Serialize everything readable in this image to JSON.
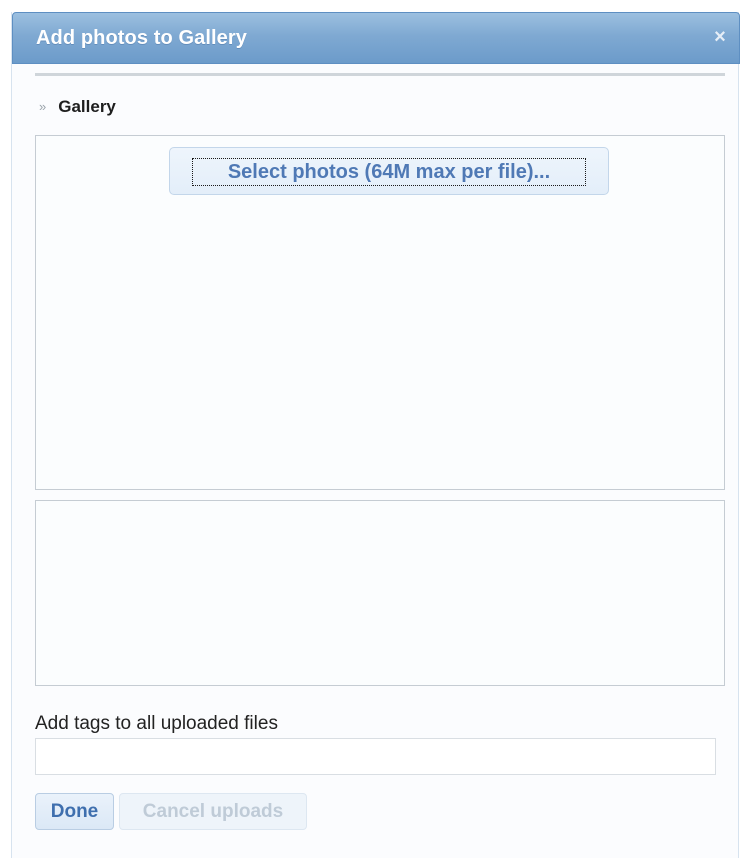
{
  "dialog": {
    "title": "Add photos to Gallery",
    "close_icon": "×"
  },
  "breadcrumb": {
    "marker": "»",
    "label": "Gallery"
  },
  "uploader": {
    "select_label": "Select photos (64M max per file)..."
  },
  "tags": {
    "label": "Add tags to all uploaded files",
    "value": "",
    "placeholder": ""
  },
  "actions": {
    "done_label": "Done",
    "cancel_label": "Cancel uploads",
    "cancel_enabled": false
  },
  "colors": {
    "titlebar": "#7fa9d2",
    "accent_text": "#4f79b5",
    "disabled_text": "#bfcbd7"
  }
}
